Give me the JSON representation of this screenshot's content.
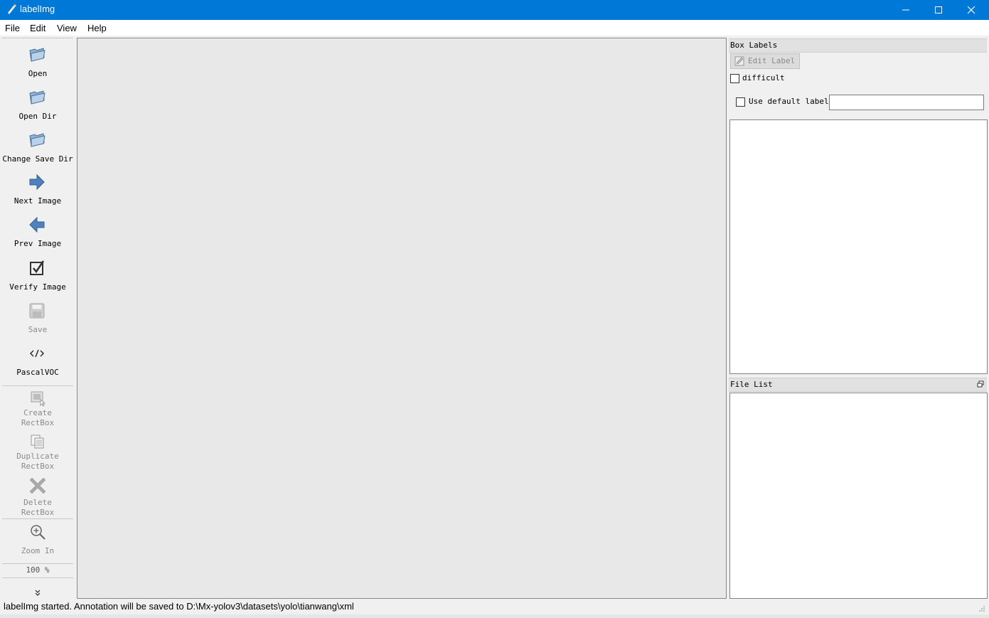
{
  "window": {
    "title": "labelImg",
    "icon": "labelimg-icon",
    "titlebar_color": "#0078d7"
  },
  "menu": [
    "File",
    "Edit",
    "View",
    "Help"
  ],
  "toolbar": {
    "tools": [
      {
        "label": "Open",
        "icon": "folder-open-icon",
        "enabled": true
      },
      {
        "label": "Open Dir",
        "icon": "folder-open-icon",
        "enabled": true
      },
      {
        "label": "Change Save Dir",
        "icon": "folder-open-icon",
        "enabled": true
      },
      {
        "label": "Next Image",
        "icon": "arrow-right-icon",
        "enabled": true
      },
      {
        "label": "Prev Image",
        "icon": "arrow-left-icon",
        "enabled": true
      },
      {
        "label": "Verify Image",
        "icon": "checkbox-icon",
        "enabled": true
      },
      {
        "label": "Save",
        "icon": "save-icon",
        "enabled": false
      },
      {
        "label": "PascalVOC",
        "icon": "code-icon",
        "enabled": true
      },
      {
        "label": "Create\nRectBox",
        "icon": "create-rectbox-icon",
        "enabled": false
      },
      {
        "label": "Duplicate\nRectBox",
        "icon": "duplicate-icon",
        "enabled": false
      },
      {
        "label": "Delete\nRectBox",
        "icon": "delete-icon",
        "enabled": false
      },
      {
        "label": "Zoom In",
        "icon": "zoom-in-icon",
        "enabled": false
      }
    ],
    "zoom_value": "100 %",
    "extension_icon": "chevron-double-down-icon"
  },
  "box_labels": {
    "title": "Box Labels",
    "edit_label_button": "Edit Label",
    "difficult_label": "difficult",
    "difficult_checked": false,
    "use_default_label": "Use default label",
    "use_default_checked": false,
    "default_label_value": ""
  },
  "file_list": {
    "title": "File List",
    "float_icon": "float-window-icon"
  },
  "status": {
    "text": "labelImg started. Annotation will be saved to D:\\Mx-yolov3\\datasets\\yolo\\tianwang\\xml"
  }
}
